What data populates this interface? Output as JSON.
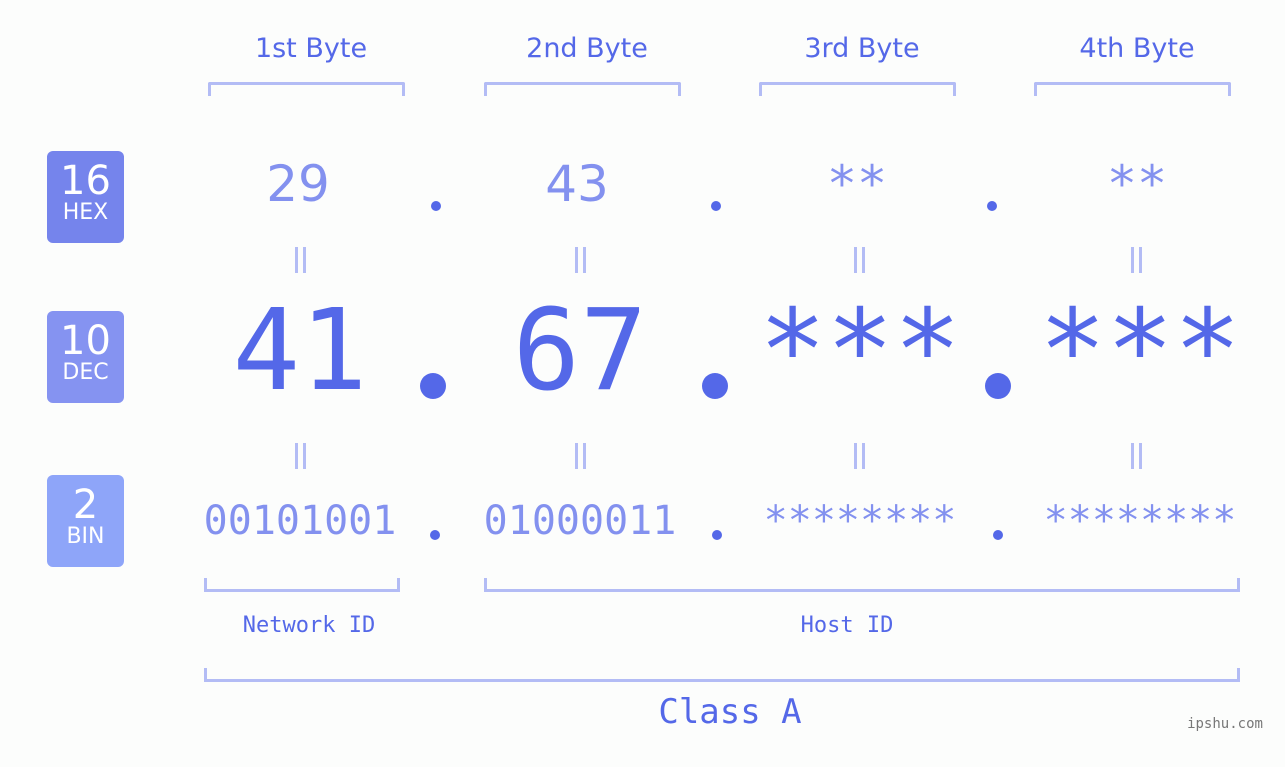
{
  "bytes": [
    {
      "label": "1st Byte",
      "hex": "29",
      "dec": "41",
      "bin": "00101001"
    },
    {
      "label": "2nd Byte",
      "hex": "43",
      "dec": "67",
      "bin": "01000011"
    },
    {
      "label": "3rd Byte",
      "hex": "**",
      "dec": "***",
      "bin": "********"
    },
    {
      "label": "4th Byte",
      "hex": "**",
      "dec": "***",
      "bin": "********"
    }
  ],
  "badges": {
    "hex": {
      "num": "16",
      "label": "HEX",
      "color": "#7584ec"
    },
    "dec": {
      "num": "10",
      "label": "DEC",
      "color": "#8593f1"
    },
    "bin": {
      "num": "2",
      "label": "BIN",
      "color": "#8ea5f9"
    }
  },
  "sections": {
    "network": "Network ID",
    "host": "Host ID",
    "class": "Class A"
  },
  "watermark": "ipshu.com"
}
